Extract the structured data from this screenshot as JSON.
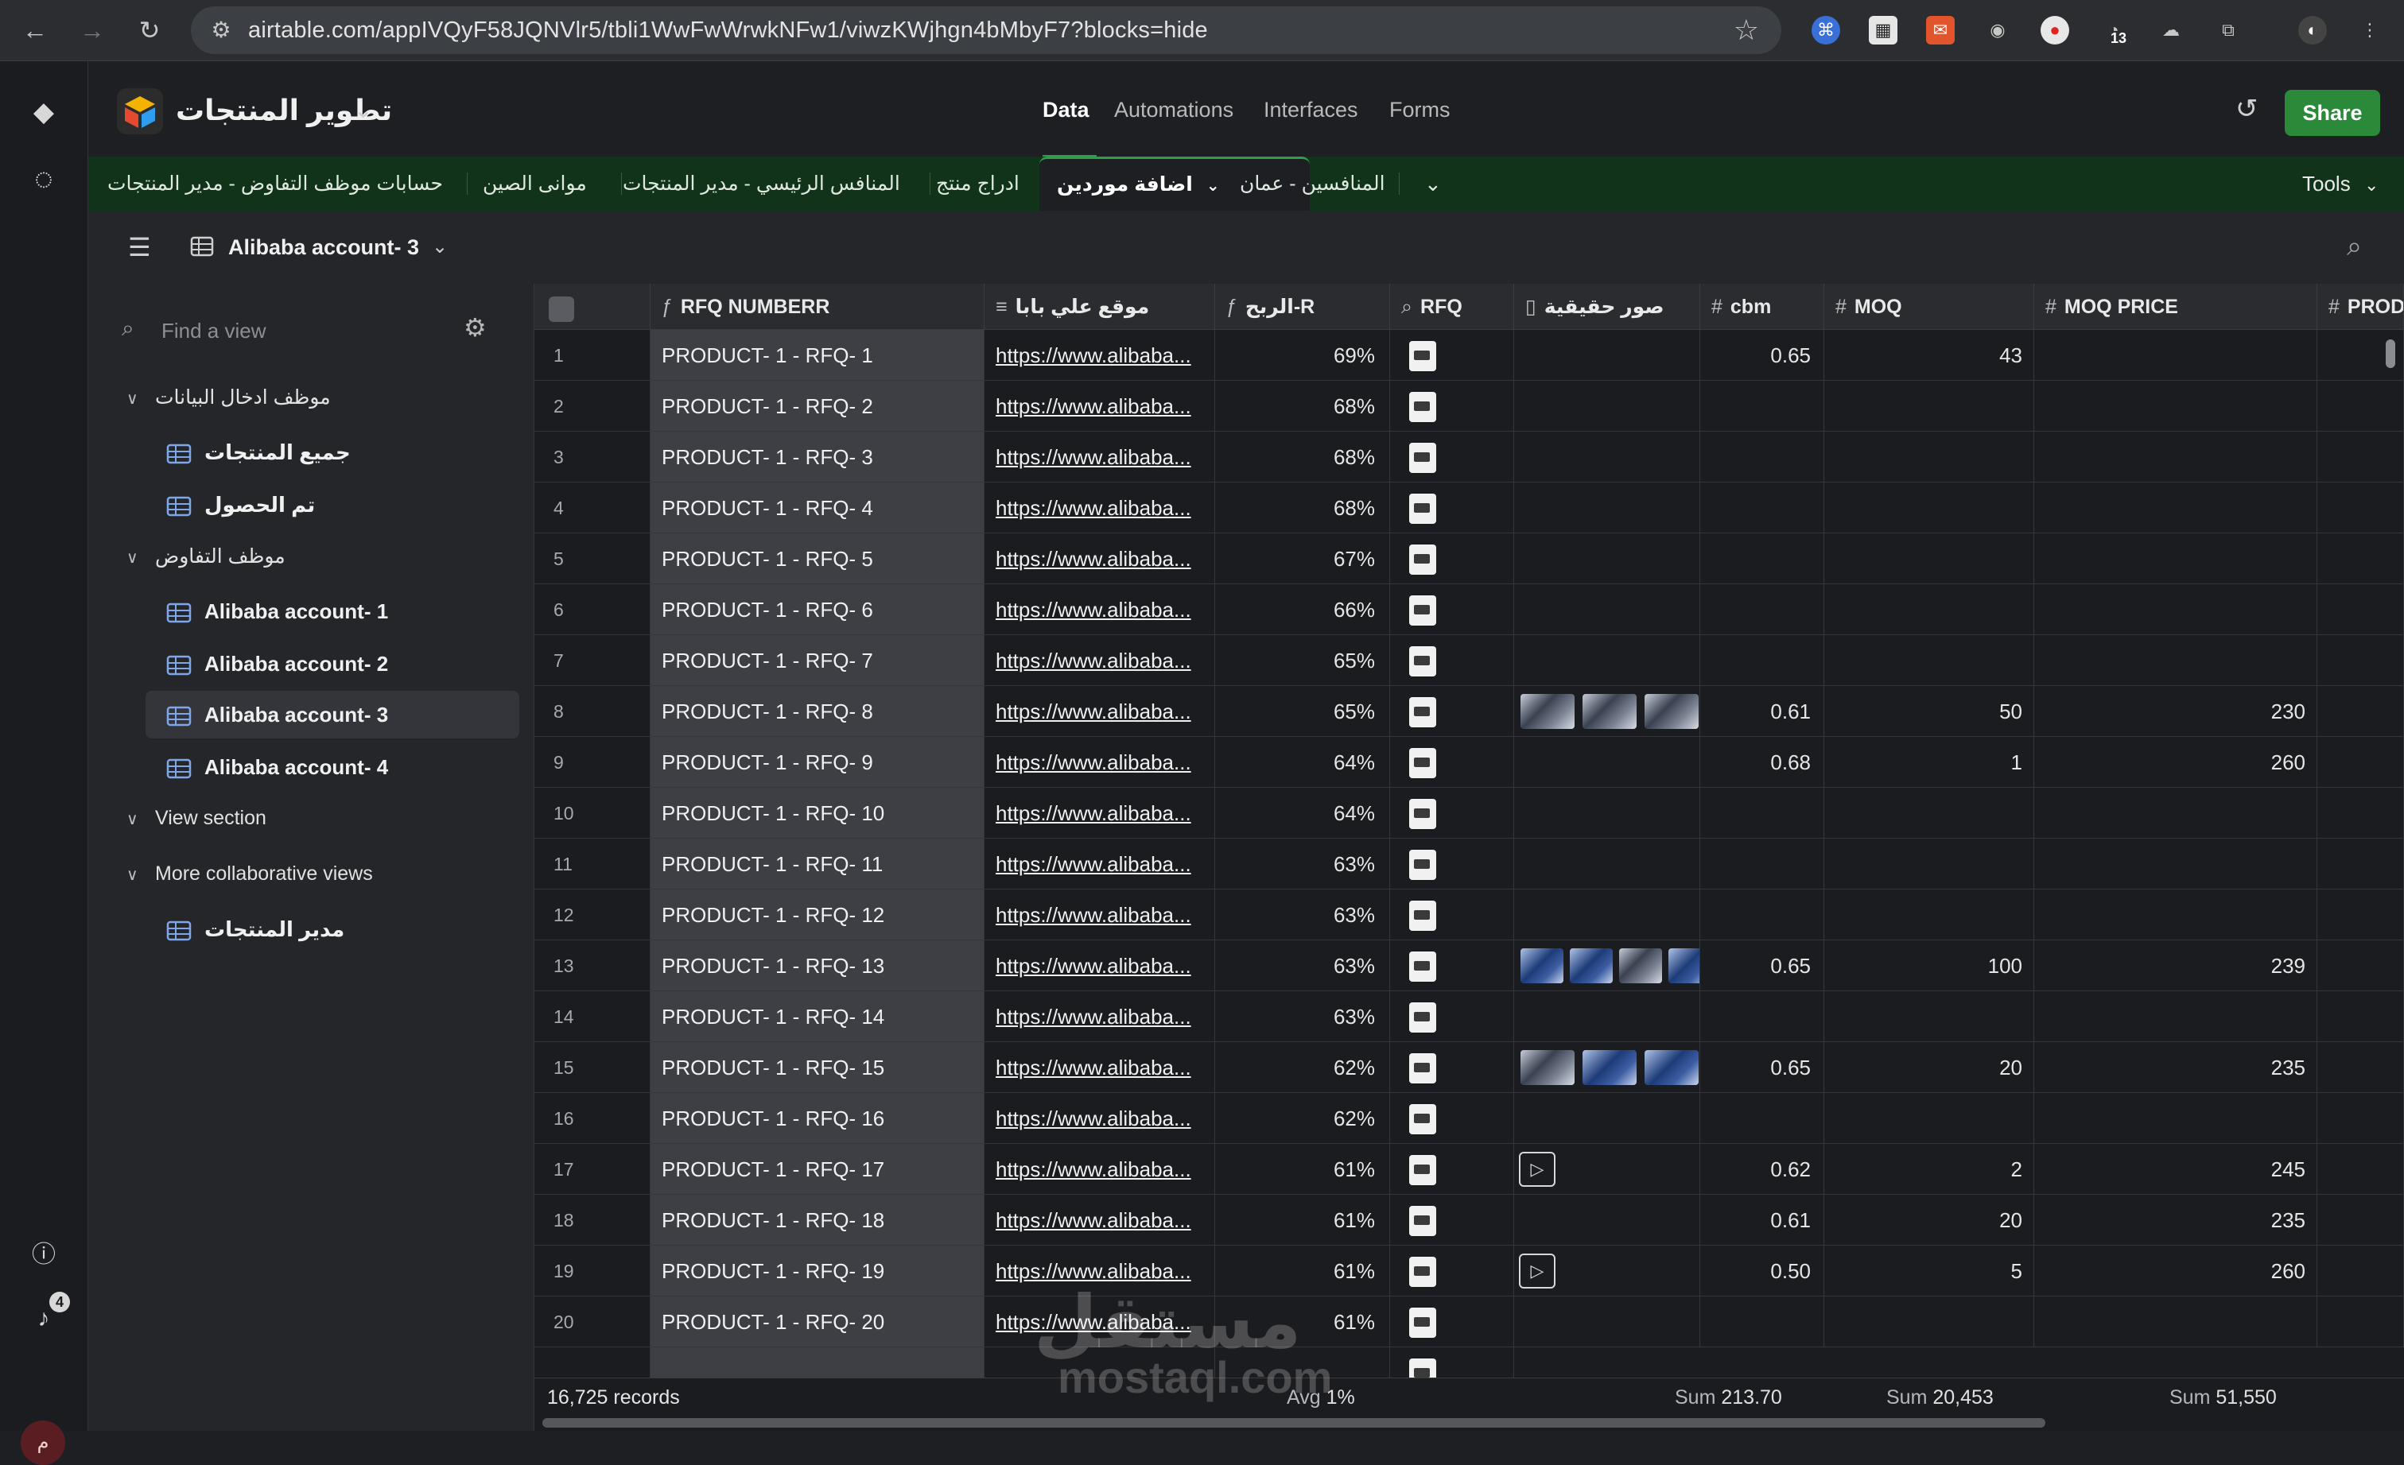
{
  "browser": {
    "url": "airtable.com/appIVQyF58JQNVlr5/tbli1WwFwWrwkNFw1/viwzKWjhgn4bMbyF7?blocks=hide",
    "ext_badge": "13"
  },
  "header": {
    "base_name": "تطوير المنتجات",
    "tabs": [
      "Data",
      "Automations",
      "Interfaces",
      "Forms"
    ],
    "share_label": "Share"
  },
  "table_tabs": {
    "items": [
      "حسابات موظف التفاوض - مدير المنتجات",
      "موانى الصين",
      "المنافس الرئيسي - مدير المنتجات",
      "ادراج منتج",
      "اضافة موردين",
      "المنافسين - عمان"
    ],
    "tools_label": "Tools"
  },
  "viewbar": {
    "view_name": "Alibaba account- 3"
  },
  "sidebar": {
    "find_placeholder": "Find a view",
    "sections": [
      {
        "title": "موظف ادخال البيانات",
        "items": [
          "جميع المنتجات",
          "تم الحصول"
        ]
      },
      {
        "title": "موظف التفاوض",
        "items": [
          "Alibaba account- 1",
          "Alibaba account- 2",
          "Alibaba account- 3",
          "Alibaba account- 4"
        ]
      },
      {
        "title": "View section",
        "items": []
      },
      {
        "title": "More collaborative views",
        "items": [
          "مدير المنتجات"
        ]
      }
    ]
  },
  "rail": {
    "notifications": "4",
    "avatar_initial": "م"
  },
  "grid": {
    "columns": [
      "RFQ NUMBERR",
      "موقع علي بابا",
      "الربح-R",
      "RFQ",
      "صور حقيقية",
      "cbm",
      "MOQ",
      "MOQ PRICE",
      "PRODU"
    ],
    "rows": [
      {
        "n": "1",
        "rfq": "PRODUCT- 1 - RFQ- 1",
        "url": "https://www.alibaba...",
        "pct": "69%",
        "cbm": "0.65",
        "moq": "43",
        "price": ""
      },
      {
        "n": "2",
        "rfq": "PRODUCT- 1 - RFQ- 2",
        "url": "https://www.alibaba...",
        "pct": "68%",
        "cbm": "",
        "moq": "",
        "price": ""
      },
      {
        "n": "3",
        "rfq": "PRODUCT- 1 - RFQ- 3",
        "url": "https://www.alibaba...",
        "pct": "68%",
        "cbm": "",
        "moq": "",
        "price": ""
      },
      {
        "n": "4",
        "rfq": "PRODUCT- 1 - RFQ- 4",
        "url": "https://www.alibaba...",
        "pct": "68%",
        "cbm": "",
        "moq": "",
        "price": ""
      },
      {
        "n": "5",
        "rfq": "PRODUCT- 1 - RFQ- 5",
        "url": "https://www.alibaba...",
        "pct": "67%",
        "cbm": "",
        "moq": "",
        "price": ""
      },
      {
        "n": "6",
        "rfq": "PRODUCT- 1 - RFQ- 6",
        "url": "https://www.alibaba...",
        "pct": "66%",
        "cbm": "",
        "moq": "",
        "price": ""
      },
      {
        "n": "7",
        "rfq": "PRODUCT- 1 - RFQ- 7",
        "url": "https://www.alibaba...",
        "pct": "65%",
        "cbm": "",
        "moq": "",
        "price": ""
      },
      {
        "n": "8",
        "rfq": "PRODUCT- 1 - RFQ- 8",
        "url": "https://www.alibaba...",
        "pct": "65%",
        "cbm": "0.61",
        "moq": "50",
        "price": "230"
      },
      {
        "n": "9",
        "rfq": "PRODUCT- 1 - RFQ- 9",
        "url": "https://www.alibaba...",
        "pct": "64%",
        "cbm": "0.68",
        "moq": "1",
        "price": "260"
      },
      {
        "n": "10",
        "rfq": "PRODUCT- 1 - RFQ- 10",
        "url": "https://www.alibaba...",
        "pct": "64%",
        "cbm": "",
        "moq": "",
        "price": ""
      },
      {
        "n": "11",
        "rfq": "PRODUCT- 1 - RFQ- 11",
        "url": "https://www.alibaba...",
        "pct": "63%",
        "cbm": "",
        "moq": "",
        "price": ""
      },
      {
        "n": "12",
        "rfq": "PRODUCT- 1 - RFQ- 12",
        "url": "https://www.alibaba...",
        "pct": "63%",
        "cbm": "",
        "moq": "",
        "price": ""
      },
      {
        "n": "13",
        "rfq": "PRODUCT- 1 - RFQ- 13",
        "url": "https://www.alibaba...",
        "pct": "63%",
        "cbm": "0.65",
        "moq": "100",
        "price": "239"
      },
      {
        "n": "14",
        "rfq": "PRODUCT- 1 - RFQ- 14",
        "url": "https://www.alibaba...",
        "pct": "63%",
        "cbm": "",
        "moq": "",
        "price": ""
      },
      {
        "n": "15",
        "rfq": "PRODUCT- 1 - RFQ- 15",
        "url": "https://www.alibaba...",
        "pct": "62%",
        "cbm": "0.65",
        "moq": "20",
        "price": "235"
      },
      {
        "n": "16",
        "rfq": "PRODUCT- 1 - RFQ- 16",
        "url": "https://www.alibaba...",
        "pct": "62%",
        "cbm": "",
        "moq": "",
        "price": ""
      },
      {
        "n": "17",
        "rfq": "PRODUCT- 1 - RFQ- 17",
        "url": "https://www.alibaba...",
        "pct": "61%",
        "cbm": "0.62",
        "moq": "2",
        "price": "245"
      },
      {
        "n": "18",
        "rfq": "PRODUCT- 1 - RFQ- 18",
        "url": "https://www.alibaba...",
        "pct": "61%",
        "cbm": "0.61",
        "moq": "20",
        "price": "235"
      },
      {
        "n": "19",
        "rfq": "PRODUCT- 1 - RFQ- 19",
        "url": "https://www.alibaba...",
        "pct": "61%",
        "cbm": "0.50",
        "moq": "5",
        "price": "260"
      },
      {
        "n": "20",
        "rfq": "PRODUCT- 1 - RFQ- 20",
        "url": "https://www.alibaba...",
        "pct": "61%",
        "cbm": "",
        "moq": "",
        "price": ""
      }
    ],
    "footer": {
      "records": "16,725 records",
      "avg_label": "Avg",
      "avg_value": "1%",
      "sum_label": "Sum",
      "sum_cbm": "213.70",
      "sum_moq": "20,453",
      "sum_price": "51,550"
    }
  },
  "watermark": {
    "line1": "مستقل",
    "line2": "mostaql.com"
  }
}
